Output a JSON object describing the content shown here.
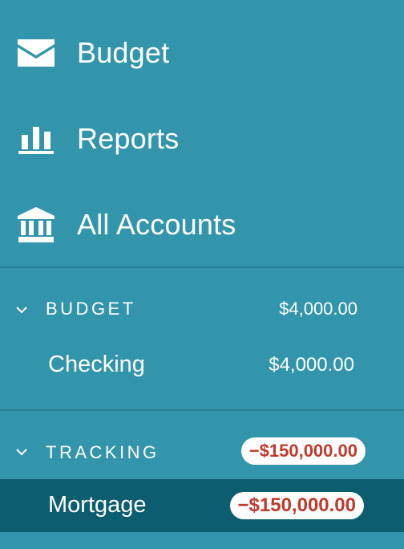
{
  "nav": {
    "budget": {
      "label": "Budget",
      "icon": "envelope-icon"
    },
    "reports": {
      "label": "Reports",
      "icon": "bar-chart-icon"
    },
    "all_accounts": {
      "label": "All Accounts",
      "icon": "bank-icon"
    }
  },
  "groups": [
    {
      "name": "BUDGET",
      "total": "$4,000.00",
      "expanded": true,
      "negative": false,
      "accounts": [
        {
          "name": "Checking",
          "balance": "$4,000.00",
          "negative": false,
          "selected": false
        }
      ]
    },
    {
      "name": "TRACKING",
      "total": "−$150,000.00",
      "expanded": true,
      "negative": true,
      "accounts": [
        {
          "name": "Mortgage",
          "balance": "−$150,000.00",
          "negative": true,
          "selected": true
        }
      ]
    }
  ],
  "colors": {
    "sidebar_bg": "#3395ab",
    "selected_bg": "#0d5d70",
    "divider": "#2a7f92",
    "negative_text": "#c0392b",
    "text": "#ffffff"
  }
}
